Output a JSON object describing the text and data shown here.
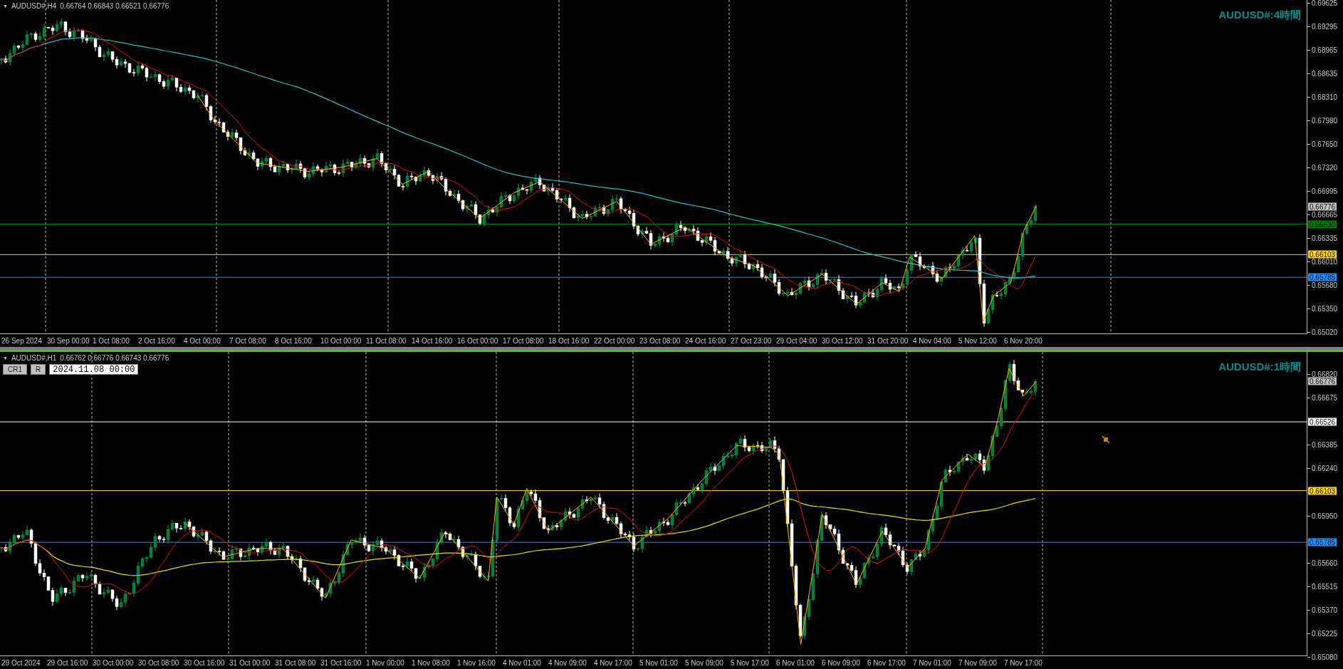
{
  "panels": [
    {
      "selected": false,
      "menu_glyph": "▼",
      "symbol": "AUDUSD#,H4",
      "ohlc": "0.66764 0.66843 0.66521 0.66776",
      "title": "AUDUSD#:4時間",
      "price_ticks": [
        "0.69625",
        "0.69295",
        "0.68965",
        "0.68635",
        "0.68310",
        "0.67980",
        "0.67650",
        "0.67320",
        "0.66995",
        "0.66665",
        "0.66335",
        "0.66010",
        "0.65680",
        "0.65350",
        "0.65020"
      ],
      "price_lines": [
        {
          "kind": "current",
          "label": "0.66776",
          "color": "#c0c0c0"
        },
        {
          "kind": "line",
          "label": "0.66530",
          "color": "#008000"
        },
        {
          "kind": "line",
          "label": "0.66103",
          "color": "#ffd700"
        },
        {
          "kind": "line",
          "label": "0.65785",
          "color": "#1e90ff"
        }
      ],
      "time_labels": [
        "26 Sep 2024",
        "30 Sep 00:00",
        "1 Oct 08:00",
        "2 Oct 16:00",
        "4 Oct 00:00",
        "7 Oct 08:00",
        "8 Oct 16:00",
        "10 Oct 00:00",
        "11 Oct 08:00",
        "14 Oct 16:00",
        "16 Oct 00:00",
        "17 Oct 08:00",
        "18 Oct 16:00",
        "22 Oct 00:00",
        "23 Oct 08:00",
        "24 Oct 16:00",
        "27 Oct 23:00",
        "29 Oct 04:00",
        "30 Oct 12:00",
        "31 Oct 20:00",
        "4 Nov 04:00",
        "5 Nov 12:00",
        "6 Nov 20:00"
      ]
    },
    {
      "selected": true,
      "menu_glyph": "▼",
      "symbol": "AUDUSD#,H1",
      "ohlc": "0.66762 0.66776 0.66743 0.66776",
      "title": "AUDUSD#:1時間",
      "tools": {
        "buttons": [
          "CR1",
          "R"
        ],
        "date_value": "2024.11.08 00:00"
      },
      "price_ticks": [
        "0.66820",
        "0.66675",
        "0.66385",
        "0.66240",
        "0.65950",
        "0.65660",
        "0.65515",
        "0.65370",
        "0.65225",
        "0.65080"
      ],
      "price_lines": [
        {
          "kind": "current",
          "label": "0.66776",
          "color": "#c0c0c0"
        },
        {
          "kind": "line",
          "label": "0.66526",
          "color": "#ffffff"
        },
        {
          "kind": "line",
          "label": "0.66103",
          "color": "#ffd700"
        },
        {
          "kind": "line",
          "label": "0.65785",
          "color": "#1e90ff"
        }
      ],
      "time_labels": [
        "29 Oct 2024",
        "29 Oct 16:00",
        "30 Oct 00:00",
        "30 Oct 08:00",
        "30 Oct 16:00",
        "31 Oct 00:00",
        "31 Oct 08:00",
        "31 Oct 16:00",
        "1 Nov 00:00",
        "1 Nov 08:00",
        "1 Nov 16:00",
        "4 Nov 01:00",
        "4 Nov 09:00",
        "4 Nov 17:00",
        "5 Nov 01:00",
        "5 Nov 09:00",
        "5 Nov 17:00",
        "6 Nov 01:00",
        "6 Nov 09:00",
        "6 Nov 17:00",
        "7 Nov 01:00",
        "7 Nov 09:00",
        "7 Nov 17:00"
      ]
    }
  ]
}
